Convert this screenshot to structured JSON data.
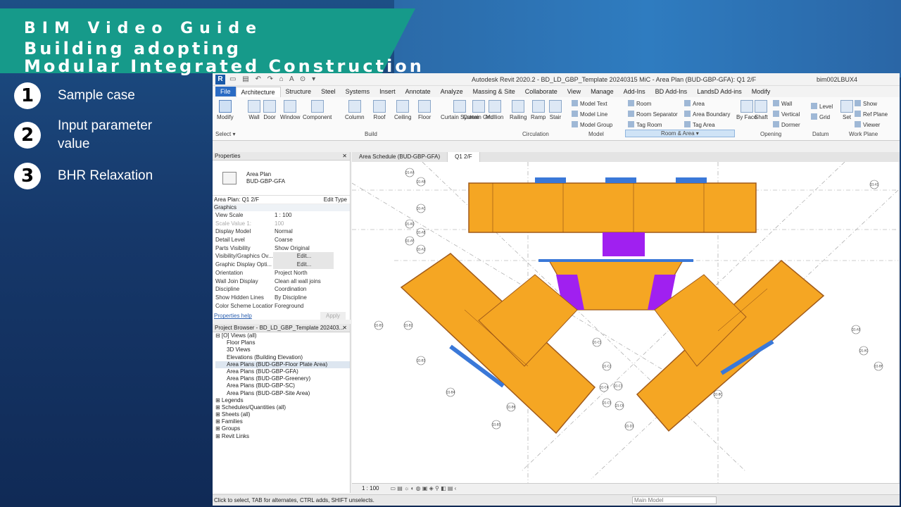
{
  "slide": {
    "title_lines": [
      "BIM Video Guide",
      "Building adopting",
      "Modular Integrated Construction"
    ],
    "steps": [
      {
        "num": "1",
        "label": "Sample case"
      },
      {
        "num": "2",
        "label": "Input parameter value"
      },
      {
        "num": "3",
        "label": "BHR Relaxation"
      }
    ]
  },
  "revit": {
    "window_title": "Autodesk Revit 2020.2 - BD_LD_GBP_Template 20240315 MiC - Area Plan (BUD-GBP-GFA): Q1 2/F",
    "user": "bim002LBUX4",
    "tabs": [
      "File",
      "Architecture",
      "Structure",
      "Steel",
      "Systems",
      "Insert",
      "Annotate",
      "Analyze",
      "Massing & Site",
      "Collaborate",
      "View",
      "Manage",
      "Add-Ins",
      "BD Add-Ins",
      "LandsD Add-ins",
      "Modify"
    ],
    "ribbon": {
      "modify": "Modify",
      "select": "Select ▾",
      "build": [
        "Wall",
        "Door",
        "Window",
        "Component",
        "Column",
        "Roof",
        "Ceiling",
        "Floor",
        "Curtain System",
        "Curtain Grid",
        "Mullion"
      ],
      "circulation": [
        "Railing",
        "Ramp",
        "Stair"
      ],
      "model": [
        "Model Text",
        "Model Line",
        "Model Group"
      ],
      "room_area": [
        "Room",
        "Room Separator",
        "Tag Room",
        "Area",
        "Area Boundary",
        "Tag Area"
      ],
      "opening": [
        "By Face",
        "Shaft",
        "Wall",
        "Vertical",
        "Dormer"
      ],
      "datum": [
        "Level",
        "Grid"
      ],
      "work_plane": [
        "Set",
        "Show",
        "Ref Plane",
        "Viewer"
      ],
      "groups": [
        "Build",
        "Circulation",
        "Model",
        "Room & Area ▾",
        "Opening",
        "Datum",
        "Work Plane"
      ]
    },
    "properties": {
      "header": "Properties",
      "type_name": "Area Plan",
      "type_sub": "BUD-GBP-GFA",
      "instance": "Area Plan: Q1 2/F",
      "edit_type": "Edit Type",
      "group": "Graphics",
      "rows": [
        {
          "k": "View Scale",
          "v": "1 : 100"
        },
        {
          "k": "Scale Value    1:",
          "v": "100"
        },
        {
          "k": "Display Model",
          "v": "Normal"
        },
        {
          "k": "Detail Level",
          "v": "Coarse"
        },
        {
          "k": "Parts Visibility",
          "v": "Show Original"
        },
        {
          "k": "Visibility/Graphics Ov...",
          "v": "Edit..."
        },
        {
          "k": "Graphic Display Opti...",
          "v": "Edit..."
        },
        {
          "k": "Orientation",
          "v": "Project North"
        },
        {
          "k": "Wall Join Display",
          "v": "Clean all wall joins"
        },
        {
          "k": "Discipline",
          "v": "Coordination"
        },
        {
          "k": "Show Hidden Lines",
          "v": "By Discipline"
        },
        {
          "k": "Color Scheme Location",
          "v": "Foreground"
        }
      ],
      "help": "Properties help",
      "apply": "Apply"
    },
    "browser": {
      "header": "Project Browser - BD_LD_GBP_Template 202403...",
      "items": [
        {
          "t": "⊟ [O] Views (all)",
          "lvl": 0
        },
        {
          "t": "Floor Plans",
          "lvl": 1
        },
        {
          "t": "3D Views",
          "lvl": 1
        },
        {
          "t": "Elevations (Building Elevation)",
          "lvl": 1
        },
        {
          "t": "Area Plans (BUD-GBP-Floor Plate Area)",
          "lvl": 1
        },
        {
          "t": "Area Plans (BUD-GBP-GFA)",
          "lvl": 1
        },
        {
          "t": "Area Plans (BUD-GBP-Greenery)",
          "lvl": 1
        },
        {
          "t": "Area Plans (BUD-GBP-SC)",
          "lvl": 1
        },
        {
          "t": "Area Plans (BUD-GBP-Site Area)",
          "lvl": 1
        },
        {
          "t": "Legends",
          "lvl": 0
        },
        {
          "t": "Schedules/Quantities (all)",
          "lvl": 0
        },
        {
          "t": "Sheets (all)",
          "lvl": 0
        },
        {
          "t": "Families",
          "lvl": 0
        },
        {
          "t": "Groups",
          "lvl": 0
        },
        {
          "t": "Revit Links",
          "lvl": 0
        }
      ]
    },
    "view_tabs": [
      "Area Schedule (BUD-GBP-GFA)",
      "Q1 2/F"
    ],
    "view_scale": "1 : 100",
    "status": "Click to select, TAB for alternates, CTRL adds, SHIFT unselects.",
    "main_model": "Main Model",
    "grid_tags": [
      "Q1-AA",
      "Q1-AB",
      "Q1-AC",
      "Q1-AD",
      "Q1-AE",
      "Q1-AF",
      "Q1-A2",
      "Q1-B1",
      "Q1-B2",
      "Q1-B3",
      "Q1-B4",
      "Q1-B5",
      "Q1-B6",
      "Q1-C1",
      "Q1-C2",
      "Q1-C3",
      "Q1-C4",
      "Q1-C5",
      "Q1-C6",
      "Q1-D1",
      "Q1-A1",
      "Q1-A0",
      "Q1-AG",
      "Q1-BF",
      "Q1-BC"
    ]
  },
  "colors": {
    "area_fill": "#f5a623",
    "shaft_fill": "#a020f0",
    "wall_blue": "#3a78d8"
  }
}
